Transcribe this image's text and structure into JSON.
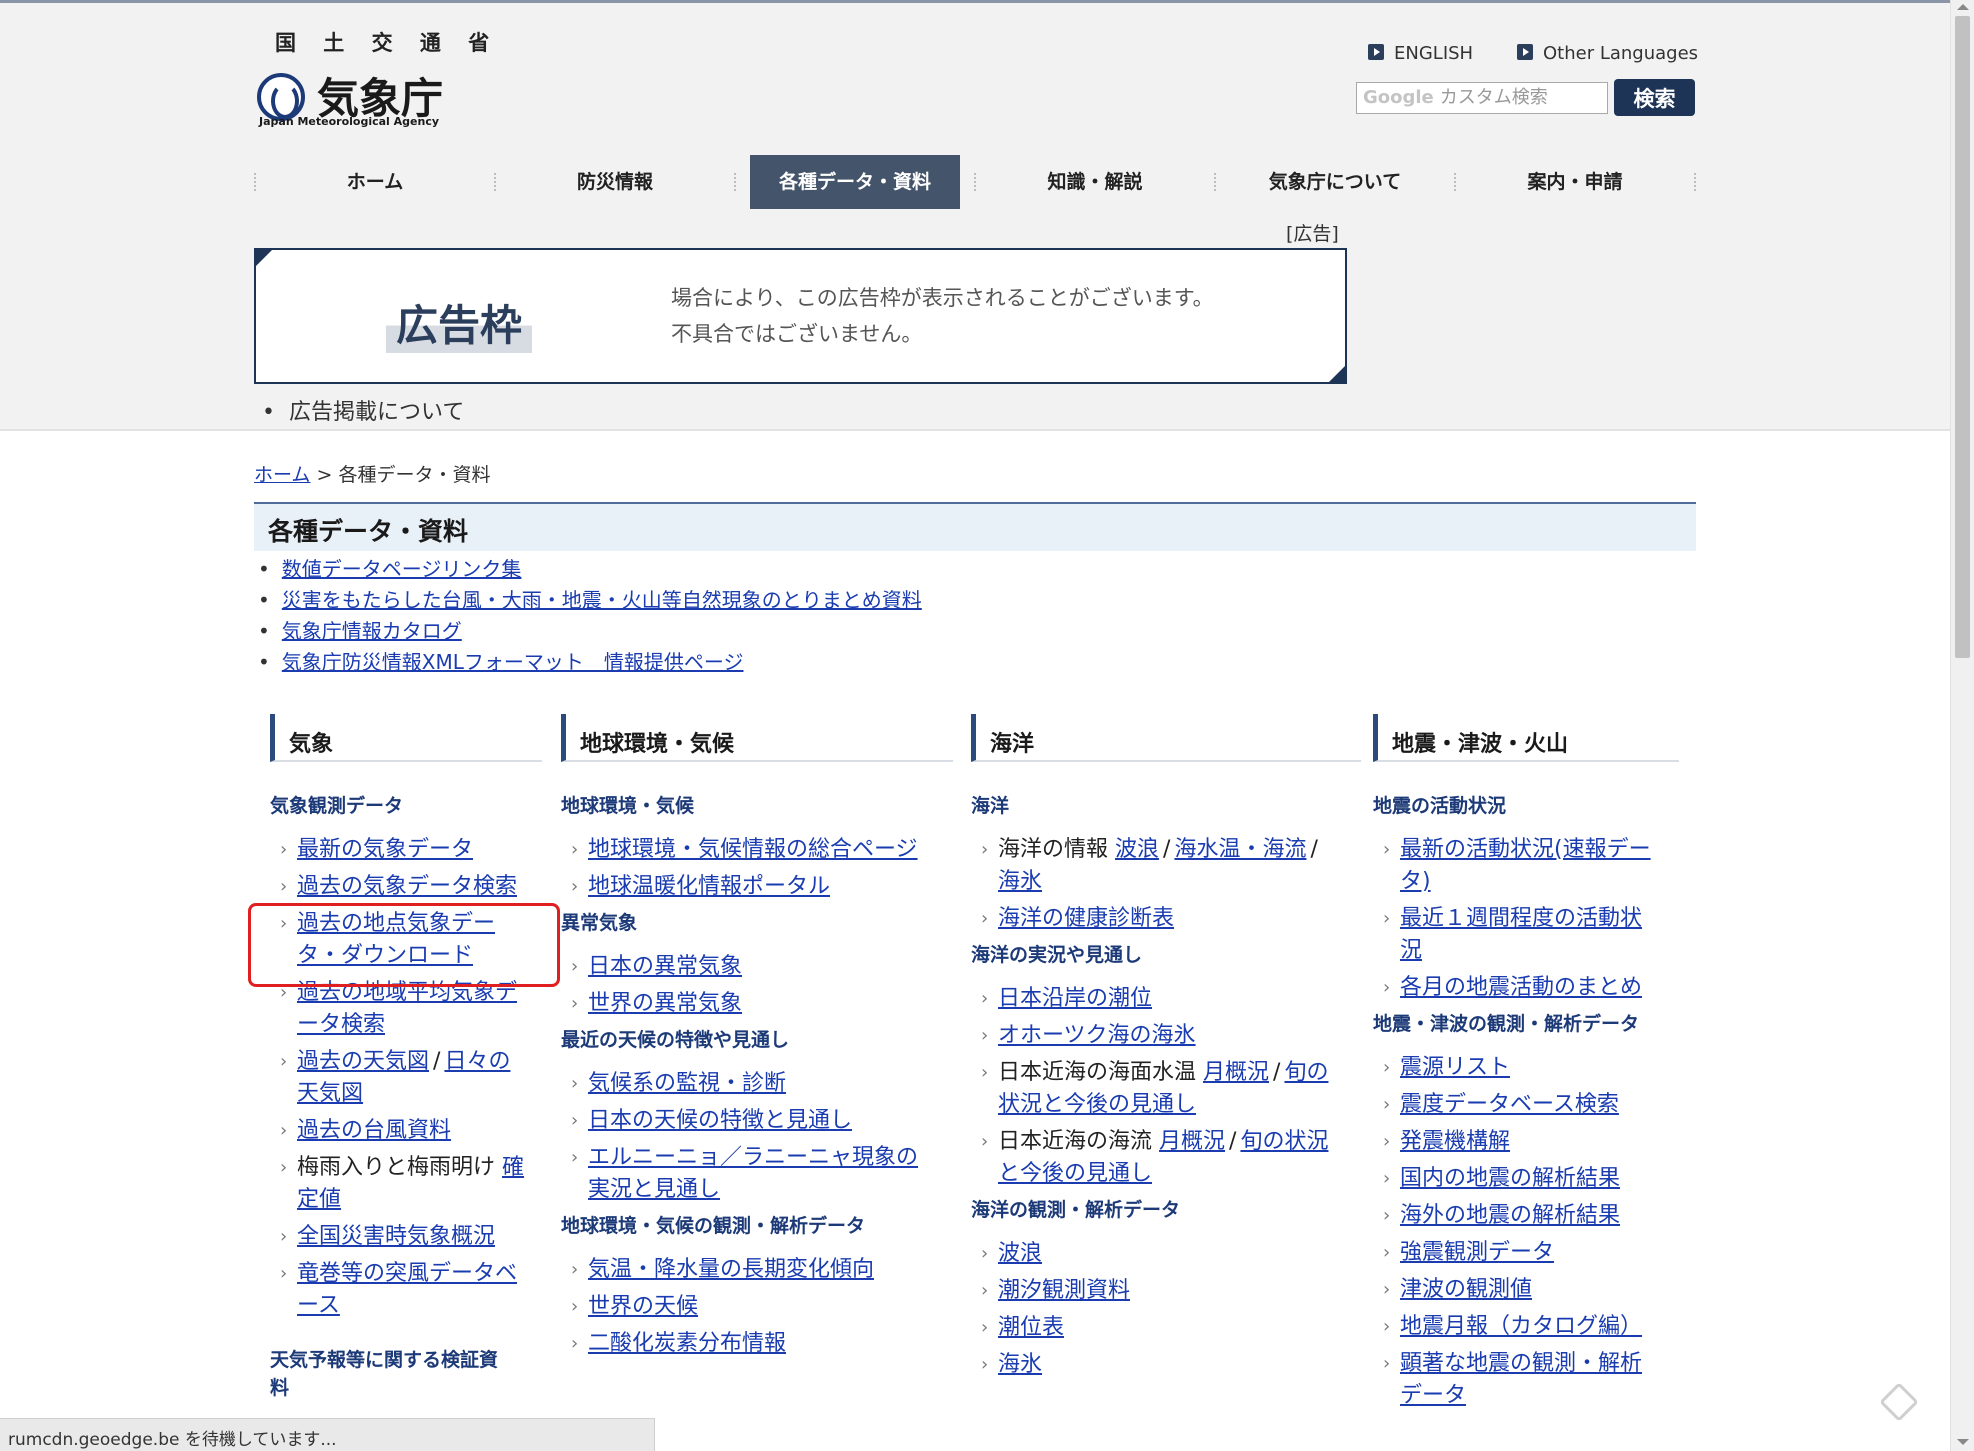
{
  "header": {
    "ministry": "国 土 交 通 省",
    "agency_name": "気象庁",
    "agency_en": "Japan Meteorological Agency",
    "lang_en": "ENGLISH",
    "lang_other": "Other Languages",
    "search_google": "Google",
    "search_placeholder": "カスタム検索",
    "search_button": "検索"
  },
  "nav": [
    "ホーム",
    "防災情報",
    "各種データ・資料",
    "知識・解説",
    "気象庁について",
    "案内・申請"
  ],
  "ad": {
    "tag": "[広告]",
    "big": "広告枠",
    "line1": "場合により、この広告枠が表示されることがございます。",
    "line2": "不具合ではございません。",
    "about": "広告掲載について"
  },
  "breadcrumb": {
    "home": "ホーム",
    "sep": " > ",
    "current": "各種データ・資料"
  },
  "page_title": "各種データ・資料",
  "top_links": [
    "数値データページリンク集",
    "災害をもたらした台風・大雨・地震・火山等自然現象のとりまとめ資料",
    "気象庁情報カタログ",
    "気象庁防災情報XMLフォーマット　情報提供ページ"
  ],
  "columns": {
    "weather": {
      "head": "気象",
      "sec1": "気象観測データ",
      "i1": "最新の気象データ",
      "i2": "過去の気象データ検索",
      "i3a": "過去の地点気象デー",
      "i3b": "タ・ダウンロード",
      "i4a": "過去の地域平均気象デ",
      "i4b": "ータ検索",
      "i5a": "過去の天気図",
      "i5sep": "/",
      "i5b": "日々の",
      "i5c": "天気図",
      "i6": "過去の台風資料",
      "i7a": "梅雨入りと梅雨明け",
      "i7b": "確",
      "i7c": "定値",
      "i8": "全国災害時気象概況",
      "i9a": "竜巻等の突風データベ",
      "i9b": "ース",
      "sec2a": "天気予報等に関する検証資",
      "sec2b": "料"
    },
    "climate": {
      "head": "地球環境・気候",
      "sec1": "地球環境・気候",
      "i1": "地球環境・気候情報の総合ページ",
      "i2": "地球温暖化情報ポータル",
      "sec2": "異常気象",
      "i3": "日本の異常気象",
      "i4": "世界の異常気象",
      "sec3": "最近の天候の特徴や見通し",
      "i5": "気候系の監視・診断",
      "i6": "日本の天候の特徴と見通し",
      "i7a": "エルニーニョ／ラニーニャ現象の",
      "i7b": "実況と見通し",
      "sec4": "地球環境・気候の観測・解析データ",
      "i8": "気温・降水量の長期変化傾向",
      "i9": "世界の天候",
      "i10": "二酸化炭素分布情報"
    },
    "ocean": {
      "head": "海洋",
      "sec1": "海洋",
      "i1a": "海洋の情報",
      "i1b": "波浪",
      "i1sep1": "/",
      "i1c": "海水温・海流",
      "i1sep2": "/",
      "i1d": "海氷",
      "i2": "海洋の健康診断表",
      "sec2": "海洋の実況や見通し",
      "i3": "日本沿岸の潮位",
      "i4": "オホーツク海の海氷",
      "i5a": "日本近海の海面水温",
      "i5b": "月概況",
      "i5sep": "/",
      "i5c": "旬の",
      "i5d": "状況と今後の見通し",
      "i6a": "日本近海の海流",
      "i6b": "月概況",
      "i6sep": "/",
      "i6c": "旬の状況",
      "i6d": "と今後の見通し",
      "sec3": "海洋の観測・解析データ",
      "i7": "波浪",
      "i8": "潮汐観測資料",
      "i9": "潮位表",
      "i10": "海氷"
    },
    "quake": {
      "head": "地震・津波・火山",
      "sec1": "地震の活動状況",
      "i1a": "最新の活動状況(速報デー",
      "i1b": "タ)",
      "i2a": "最近１週間程度の活動状",
      "i2b": "況",
      "i3": "各月の地震活動のまとめ",
      "sec2": "地震・津波の観測・解析データ",
      "i4": "震源リスト",
      "i5": "震度データベース検索",
      "i6": "発震機構解",
      "i7": "国内の地震の解析結果",
      "i8": "海外の地震の解析結果",
      "i9": "強震観測データ",
      "i10": "津波の観測値",
      "i11": "地震月報（カタログ編）",
      "i12a": "顕著な地震の観測・解析",
      "i12b": "データ"
    }
  },
  "status_bar": "rumcdn.geoedge.be を待機しています..."
}
